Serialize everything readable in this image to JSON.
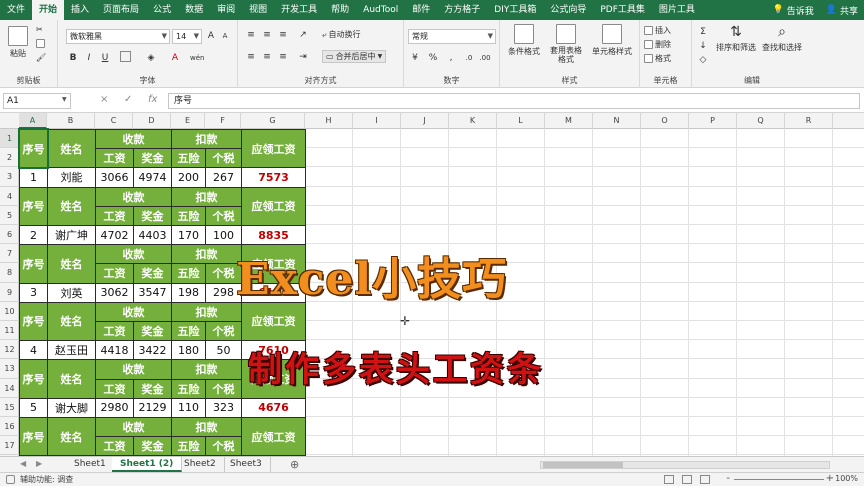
{
  "menu": {
    "items": [
      "文件",
      "开始",
      "插入",
      "页面布局",
      "公式",
      "数据",
      "审阅",
      "视图",
      "开发工具",
      "帮助",
      "AudTool",
      "邮件",
      "方方格子",
      "DIY工具箱",
      "公式向导",
      "PDF工具集",
      "图片工具"
    ],
    "active_index": 1,
    "tell_me": "告诉我",
    "share": "共享"
  },
  "ribbon": {
    "clipboard": {
      "label": "剪贴板",
      "paste": "粘贴"
    },
    "font": {
      "label": "字体",
      "font_name": "微软雅黑",
      "font_size": "14",
      "bold": "B",
      "italic": "I",
      "underline": "U",
      "grow": "A",
      "shrink": "A",
      "pinyin": "wén"
    },
    "alignment": {
      "label": "对齐方式",
      "wrap_text": "自动换行",
      "merge_center": "合并后居中"
    },
    "number": {
      "label": "数字",
      "format": "常规",
      "percent": "%",
      "comma": ",",
      "currency": "¥"
    },
    "styles": {
      "label": "样式",
      "conditional": "条件格式",
      "table_format": "套用表格格式",
      "cell_styles": "单元格样式"
    },
    "cells": {
      "label": "单元格",
      "insert": "插入",
      "delete": "删除",
      "format": "格式"
    },
    "editing": {
      "label": "编辑",
      "sum": "Σ",
      "sort_filter": "排序和筛选",
      "find_select": "查找和选择"
    }
  },
  "formula_bar": {
    "name_box": "A1",
    "cancel": "×",
    "enter": "✓",
    "fx": "fx",
    "content": "序号"
  },
  "grid": {
    "columns": [
      "A",
      "B",
      "C",
      "D",
      "E",
      "F",
      "G",
      "H",
      "I",
      "J",
      "K",
      "L",
      "M",
      "N",
      "O",
      "P",
      "Q",
      "R"
    ],
    "rows": [
      "1",
      "2",
      "3",
      "4",
      "5",
      "6",
      "7",
      "8",
      "9",
      "10",
      "11",
      "12",
      "13",
      "14",
      "15",
      "16",
      "17"
    ],
    "selected_cell": "A1"
  },
  "table": {
    "header": {
      "seq": "序号",
      "name": "姓名",
      "income": "收款",
      "deduction": "扣款",
      "salary": "工资",
      "bonus": "奖金",
      "insurance": "五险",
      "tax": "个税",
      "payable": "应领工资"
    },
    "records": [
      {
        "seq": "1",
        "name": "刘能",
        "salary": "3066",
        "bonus": "4974",
        "insurance": "200",
        "tax": "267",
        "payable": "7573"
      },
      {
        "seq": "2",
        "name": "谢广坤",
        "salary": "4702",
        "bonus": "4403",
        "insurance": "170",
        "tax": "100",
        "payable": "8835"
      },
      {
        "seq": "3",
        "name": "刘英",
        "salary": "3062",
        "bonus": "3547",
        "insurance": "198",
        "tax": "298",
        "payable": "6113"
      },
      {
        "seq": "4",
        "name": "赵玉田",
        "salary": "4418",
        "bonus": "3422",
        "insurance": "180",
        "tax": "50",
        "payable": "7610"
      },
      {
        "seq": "5",
        "name": "谢大脚",
        "salary": "2980",
        "bonus": "2129",
        "insurance": "110",
        "tax": "323",
        "payable": "4676"
      }
    ]
  },
  "overlay": {
    "title": "Excel小技巧",
    "subtitle": "制作多表头工资条"
  },
  "sheets": {
    "tabs": [
      "Sheet1",
      "Sheet1 (2)",
      "Sheet2",
      "Sheet3"
    ],
    "active_index": 1,
    "add": "⊕"
  },
  "status": {
    "text": "辅助功能: 调查",
    "zoom": "100%",
    "minus": "-",
    "plus": "+"
  },
  "colors": {
    "excel_green": "#217346",
    "header_green": "#75b03c",
    "payable_red": "#c00000",
    "title_orange": "#f28e1d",
    "subtitle_red": "#d01212"
  }
}
